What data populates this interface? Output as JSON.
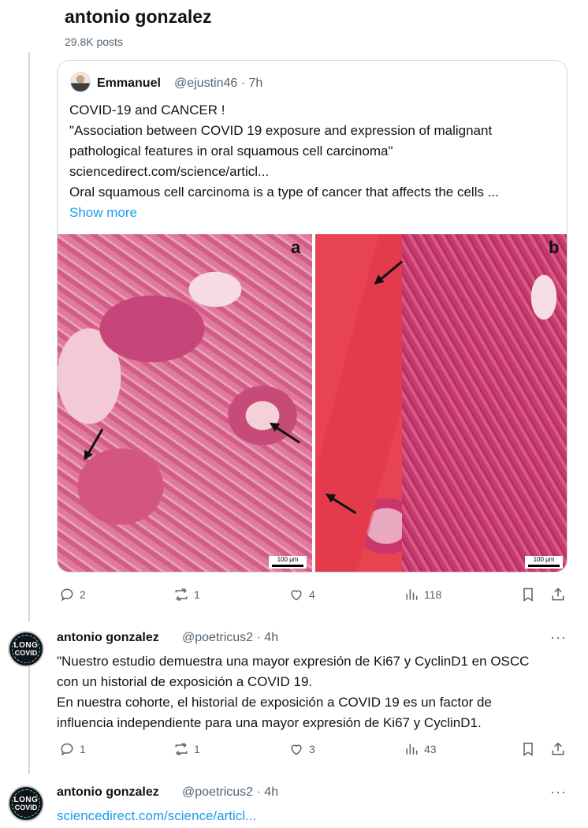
{
  "header": {
    "name": "antonio gonzalez",
    "posts": "29.8K posts"
  },
  "quoted_post": {
    "author_name": "Emmanuel",
    "handle": "@ejustin46",
    "time": "7h",
    "lines": [
      "COVID-19 and CANCER !",
      "\"Association between COVID 19 exposure and expression of malignant",
      "pathological features in oral squamous cell carcinoma\"",
      "sciencedirect.com/science/articl...",
      "Oral squamous cell carcinoma is a type of cancer that affects the cells ..."
    ],
    "show_more": "Show more",
    "image": {
      "panel_a_label": "a",
      "panel_b_label": "b",
      "scale_a": "100 μm",
      "scale_b": "100 μm"
    },
    "actions": {
      "replies": "2",
      "reposts": "1",
      "likes": "4",
      "views": "118"
    }
  },
  "reply1": {
    "avatar_text_top": "LONG",
    "avatar_text_bottom": "COVID",
    "author_name": "antonio gonzalez",
    "handle": "@poetricus2",
    "time": "4h",
    "more": "···",
    "lines": [
      "\"Nuestro estudio demuestra una mayor expresión de Ki67 y CyclinD1 en OSCC",
      "con un historial de exposición a COVID 19.",
      "En nuestra cohorte, el historial de exposición a COVID 19 es un factor de",
      "influencia independiente para una mayor expresión de Ki67 y CyclinD1."
    ],
    "actions": {
      "replies": "1",
      "reposts": "1",
      "likes": "3",
      "views": "43"
    }
  },
  "reply2": {
    "avatar_text_top": "LONG",
    "avatar_text_bottom": "COVID",
    "author_name": "antonio gonzalez",
    "handle": "@poetricus2",
    "time": "4h",
    "more": "···",
    "link": "sciencedirect.com/science/articl..."
  },
  "colors": {
    "link": "#1d9bf0",
    "muted": "#536471",
    "text": "#0f1419",
    "border": "#cfd9de"
  },
  "icons": [
    "reply-icon",
    "repost-icon",
    "like-icon",
    "views-icon",
    "bookmark-icon",
    "share-icon",
    "more-icon"
  ]
}
